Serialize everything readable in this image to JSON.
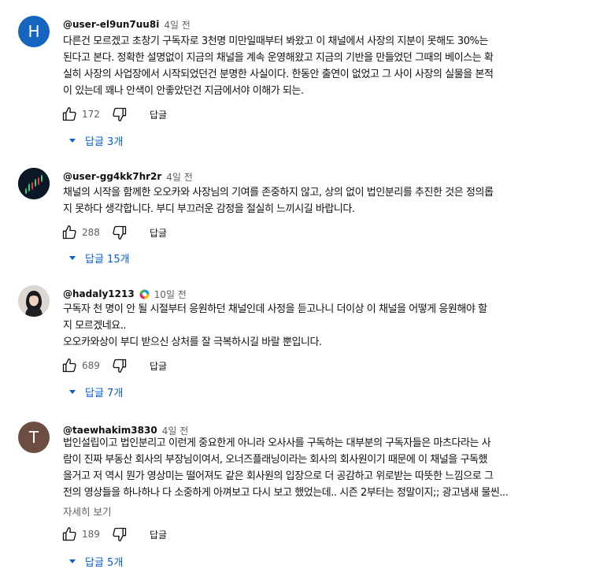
{
  "reply_label": "답글",
  "comments": [
    {
      "author": "@user-el9un7uu8i",
      "time": "4일 전",
      "avatar_letter": "H",
      "lines": [
        "다른건 모르겠고 초창기 구독자로 3천명 미만일때부터 봐왔고 이 채널에서 사장의 지분이 못해도 30%는",
        "된다고 본다. 정확한 설명없이 지금의 채널을 계속 운영해왔고 지금의 기반을 만들었던 그때의 베이스는 확",
        "실히 사장의 사업장에서 시작되었던건 분명한 사실이다. 한동안 출연이 없었고 그 사이 사장의 실물을 본적",
        "이 있는데 꽤나 안색이 안좋았던건 지금에서야 이해가 되는."
      ],
      "likes": "172",
      "replies": "답글 3개"
    },
    {
      "author": "@user-gg4kk7hr2r",
      "time": "4일 전",
      "lines": [
        "채널의 시작을 함께한 오오카와 사장님의 기여를 존중하지 않고, 상의 없이 법인분리를 추진한 것은 정의롭",
        "지 못하다 생각합니다. 부디 부끄러운 감정을 절실히 느끼시길 바랍니다."
      ],
      "likes": "288",
      "replies": "답글 15개"
    },
    {
      "author": "@hadaly1213",
      "time": "10일 전",
      "lines": [
        "구독자 천 명이 안 될 시절부터 응원하던 채널인데 사정을 듣고나니 더이상 이 채널을 어떻게 응원해야 할",
        "지 모르겠네요..",
        "오오카와상이 부디 받으신 상처를 잘 극복하시길 바랄 뿐입니다."
      ],
      "likes": "689",
      "replies": "답글 7개"
    },
    {
      "author": "@taewhakim3830",
      "time": "4일 전",
      "avatar_letter": "T",
      "lines": [
        "법인설립이고 법인분리고 이런게 중요한게 아니라 오사사를 구독하는 대부분의 구독자들은 마츠다라는 사",
        "람이 진짜 부동산 회사의 부장님이여서, 오너즈플래닝이라는 회사의 회사원이기 때문에 이 채널을 구독했",
        "을거고 저 역시 뭔가 영상미는 떨어져도 같은 회사원의 입장으로 더 공감하고 위로받는 따뜻한 느낌으로 그",
        "전의 영상들을 하나하나 다 소중하게 아껴보고 다시 보고 했었는데.. 시즌 2부터는 정말이지;; 광고냄새 물씬..."
      ],
      "show_more": "자세히 보기",
      "likes": "189",
      "replies": "답글 5개"
    }
  ]
}
